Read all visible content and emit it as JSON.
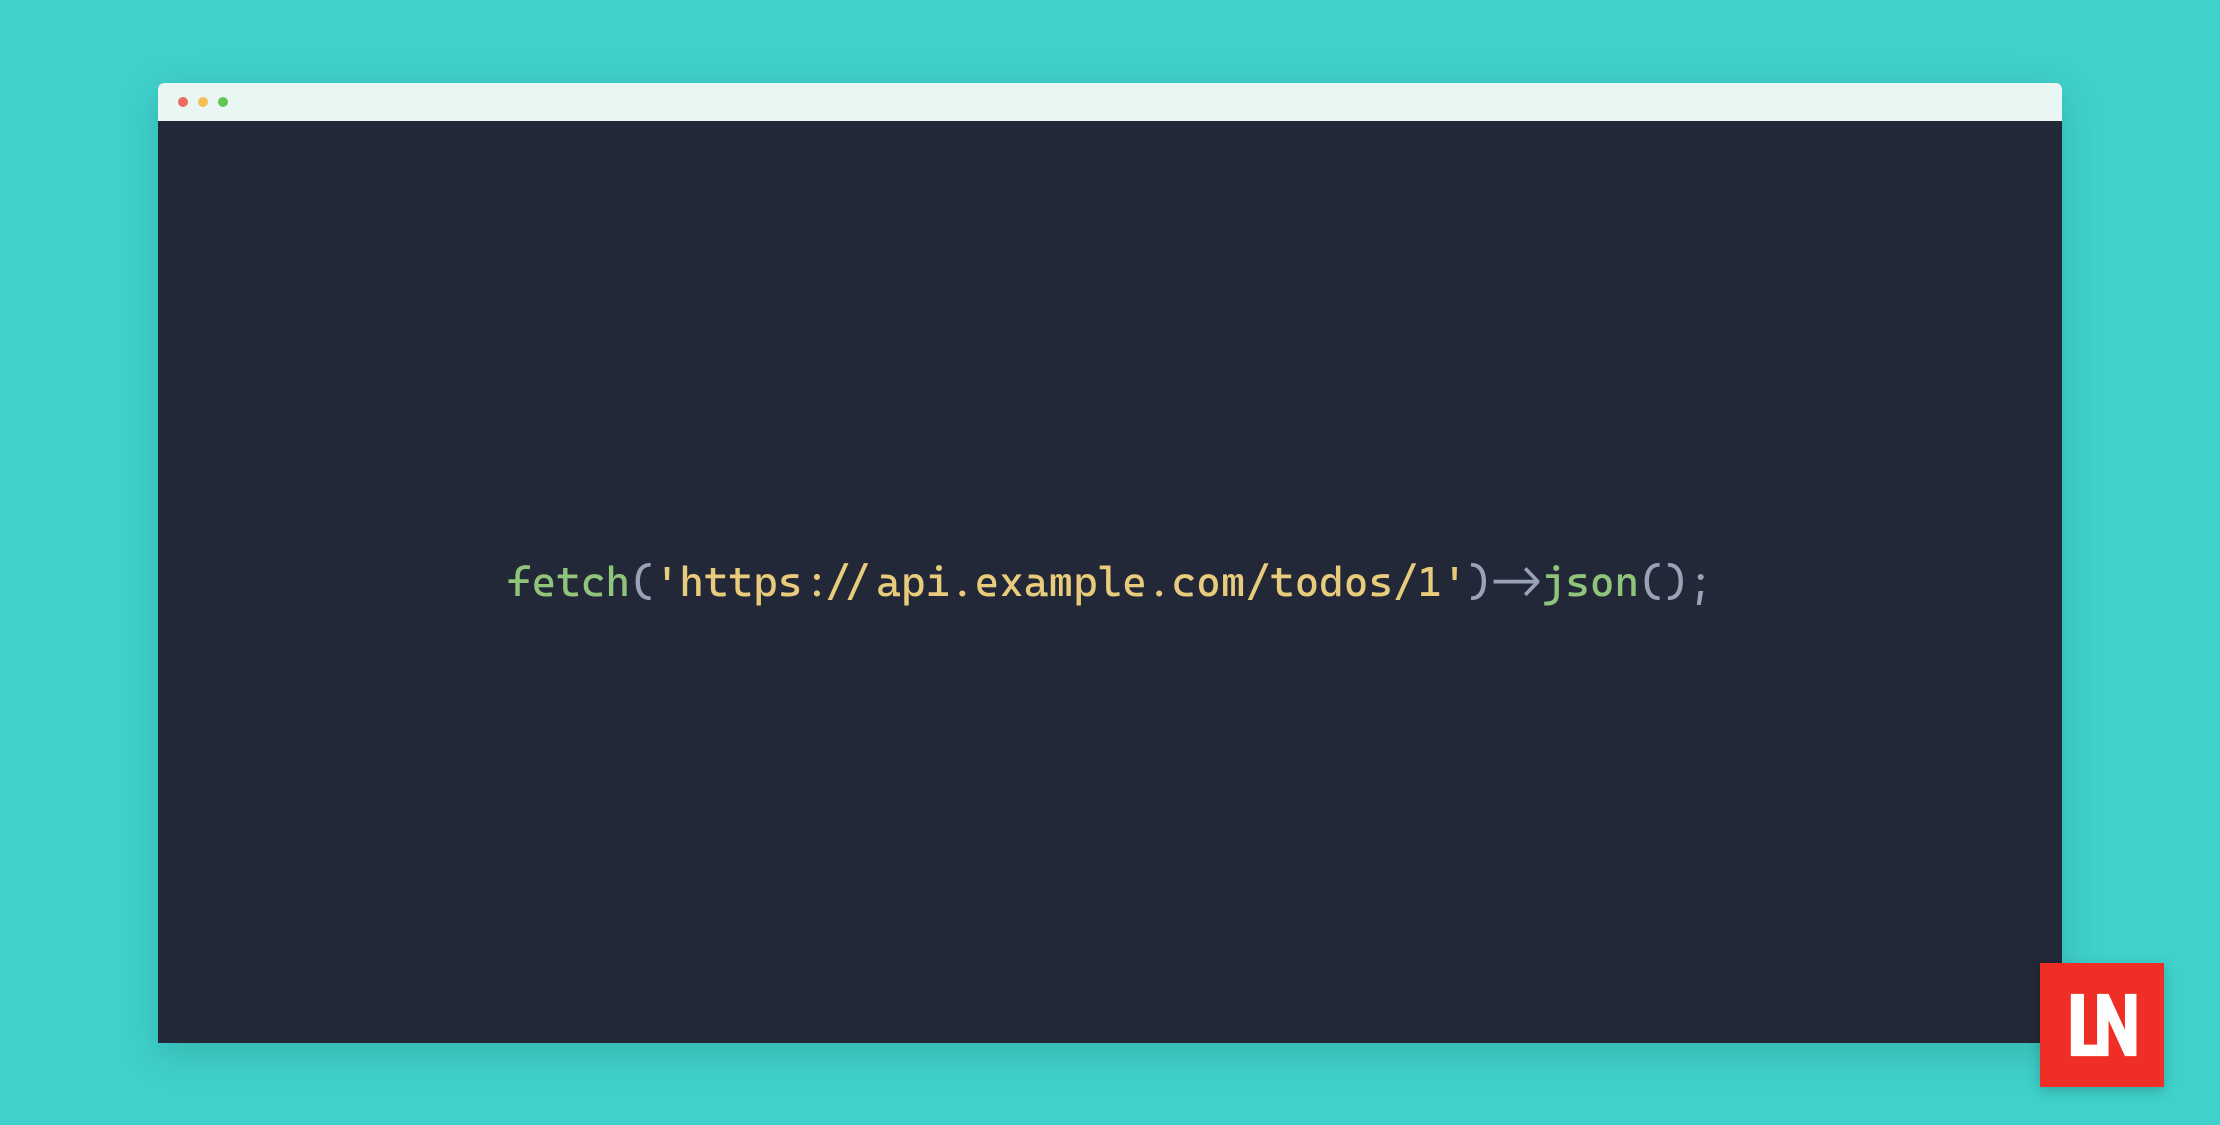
{
  "code": {
    "func": "fetch",
    "open_paren": "(",
    "string_open": "'",
    "string_content": "https://api.example.com/todos/1",
    "string_close": "'",
    "close_paren": ")",
    "arrow": "->",
    "method": "json",
    "method_open": "(",
    "method_close": ")",
    "semicolon": ";"
  },
  "logo": {
    "text": "LN"
  }
}
